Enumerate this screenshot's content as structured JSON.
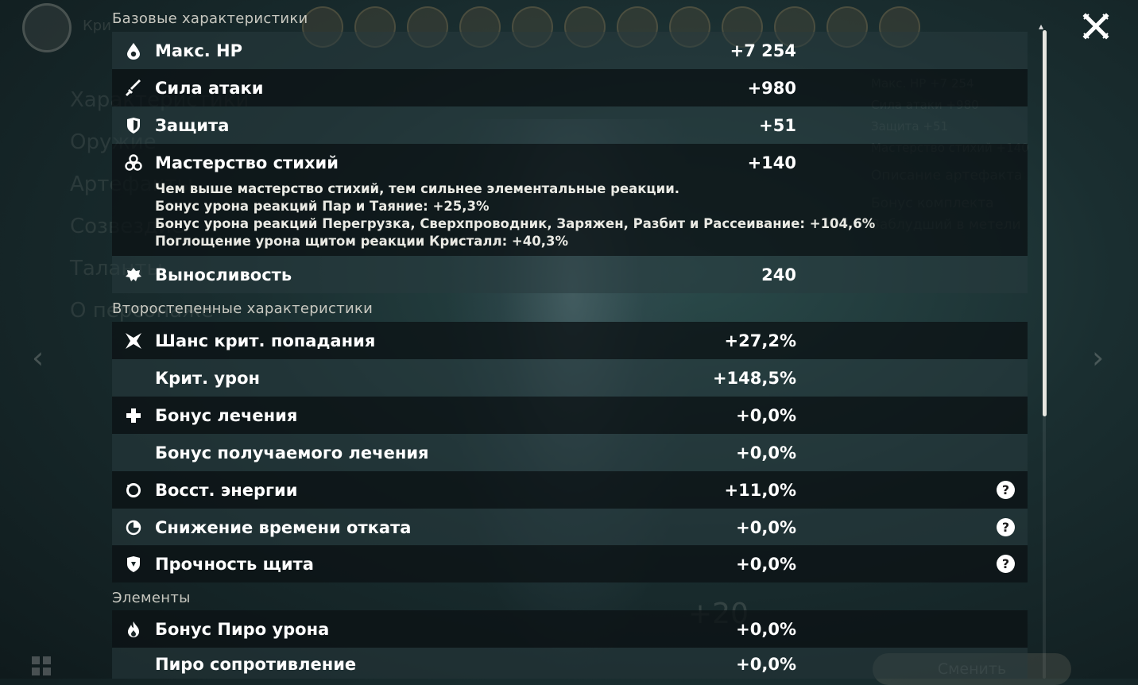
{
  "sections": {
    "base": "Базовые характеристики",
    "secondary": "Второстепенные характеристики",
    "elements": "Элементы"
  },
  "base_stats": [
    {
      "icon": "hp-drop-icon",
      "label": "Макс. HP",
      "value": "+7 254"
    },
    {
      "icon": "sword-icon",
      "label": "Сила атаки",
      "value": "+980"
    },
    {
      "icon": "shield-icon",
      "label": "Защита",
      "value": "+51"
    },
    {
      "icon": "elemental-mastery-icon",
      "label": "Мастерство стихий",
      "value": "+140"
    }
  ],
  "mastery_description": [
    "Чем выше мастерство стихий, тем сильнее элементальные реакции.",
    "Бонус урона реакций Пар и Таяние: +25,3%",
    "Бонус урона реакций Перегрузка, Сверхпроводник, Заряжен, Разбит и Рассеивание: +104,6%",
    "Поглощение урона щитом реакции Кристалл: +40,3%"
  ],
  "stamina": {
    "icon": "stamina-icon",
    "label": "Выносливость",
    "value": "240"
  },
  "secondary_stats": [
    {
      "icon": "crit-rate-icon",
      "label": "Шанс крит. попадания",
      "value": "+27,2%",
      "help": false
    },
    {
      "icon": "",
      "label": "Крит. урон",
      "value": "+148,5%",
      "help": false
    },
    {
      "icon": "healing-cross-icon",
      "label": "Бонус лечения",
      "value": "+0,0%",
      "help": false
    },
    {
      "icon": "",
      "label": "Бонус получаемого лечения",
      "value": "+0,0%",
      "help": false
    },
    {
      "icon": "energy-recharge-icon",
      "label": "Восст. энергии",
      "value": "+11,0%",
      "help": true
    },
    {
      "icon": "cooldown-icon",
      "label": "Снижение времени отката",
      "value": "+0,0%",
      "help": true
    },
    {
      "icon": "shield-strength-icon",
      "label": "Прочность щита",
      "value": "+0,0%",
      "help": true
    }
  ],
  "element_stats": [
    {
      "icon": "pyro-icon",
      "label": "Бонус Пиро урона",
      "value": "+0,0%"
    },
    {
      "icon": "",
      "label": "Пиро сопротивление",
      "value": "+0,0%"
    }
  ],
  "help_glyph": "?",
  "background": {
    "left_menu": [
      "Характеристики",
      "Оружие",
      "Артефакты",
      "Созвездие",
      "Таланты",
      "О персонаже"
    ],
    "top_left_text": "Кри",
    "right_panel": [
      "Макс. HP   +7 254",
      "Сила атаки   +980",
      "Защита   +51",
      "Мастерство стихий  +140",
      "Описание артефакта",
      "Бонус комплекта",
      "Заблудший в метели"
    ],
    "level_text": "+20",
    "change_button": "Сменить"
  },
  "colors": {
    "accent_white": "#ffffff",
    "row_dark": "#0c1214",
    "row_light": "#283a3e"
  }
}
